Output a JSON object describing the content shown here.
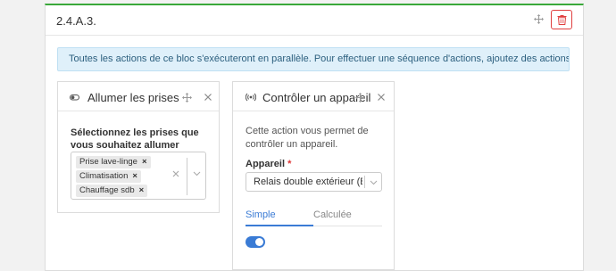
{
  "block": {
    "title": "2.4.A.3.",
    "info": "Toutes les actions de ce bloc s'exécuteront en parallèle. Pour effectuer une séquence d'actions, ajoutez des actions au bloc suivant."
  },
  "card_plugs": {
    "title": "Allumer les prises",
    "field_label": "Sélectionnez les prises que vous souhaitez allumer",
    "tags": [
      {
        "label": "Prise lave-linge",
        "remove": "×"
      },
      {
        "label": "Climatisation",
        "remove": "×"
      },
      {
        "label": "Chauffage sdb",
        "remove": "×"
      }
    ]
  },
  "card_device": {
    "title": "Contrôler un appareil",
    "description": "Cette action vous permet de contrôler un appareil.",
    "device_label": "Appareil",
    "required_mark": "*",
    "device_value": "Relais double extérieur (Born...",
    "tabs": [
      "Simple",
      "Calculée"
    ],
    "active_tab": "Simple",
    "toggle_on": true
  },
  "colors": {
    "accent": "#3a7bd5",
    "header_border": "#3aa83a",
    "danger": "#e03e3e",
    "info_bg": "#dff0fa"
  }
}
